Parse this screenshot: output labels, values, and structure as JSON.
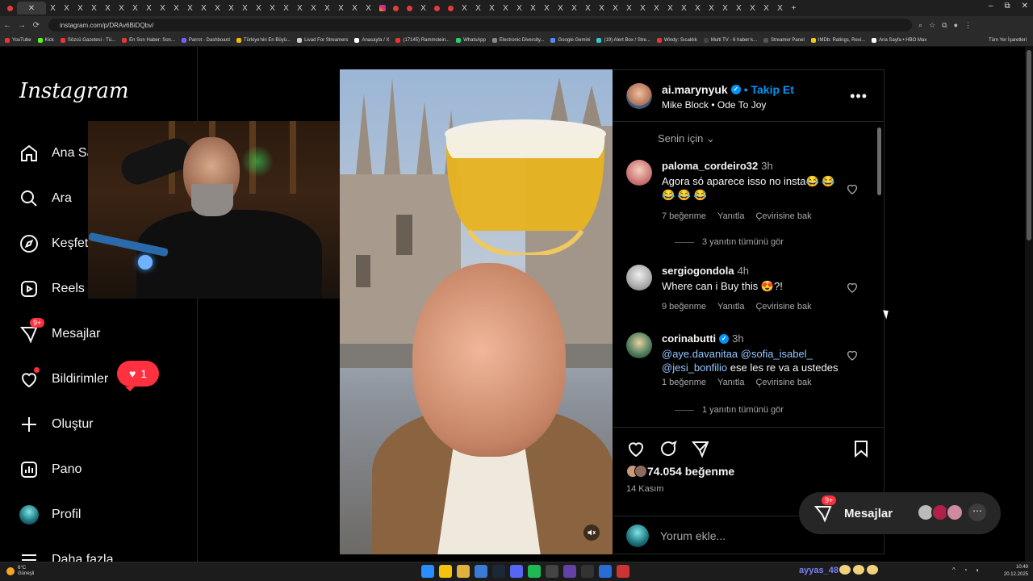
{
  "browser": {
    "url": "instagram.com/p/DRAv6BiDQbv/",
    "bookmarks": [
      "YouTube",
      "Kick",
      "Sözcü Gazetesi - Tü...",
      "En Son Haber: Son...",
      "Parrot - Dashboard",
      "Türkiye'nin En Büyü...",
      "Livad For Streamers",
      "Anasayfa / X",
      "(17145) Rammstein...",
      "WhatsApp",
      "Electronic Diversity...",
      "Google Gemini",
      "(19) Alert Box / Stre...",
      "Windy: Sıcaklık",
      "Multi TV - 6 haber k...",
      "Streamer Panel",
      "IMDb: Ratings, Revi...",
      "Ana Sayfa • HBO Max"
    ],
    "bookmarks_right": "Tüm Yer İşaretleri"
  },
  "sidebar": {
    "logo": "Instagram",
    "items": [
      {
        "label": "Ana Sayfa",
        "icon": "home-icon"
      },
      {
        "label": "Ara",
        "icon": "search-icon"
      },
      {
        "label": "Keşfet",
        "icon": "compass-icon"
      },
      {
        "label": "Reels",
        "icon": "reels-icon"
      },
      {
        "label": "Mesajlar",
        "icon": "messenger-icon",
        "badge": "9+"
      },
      {
        "label": "Bildirimler",
        "icon": "heart-icon"
      },
      {
        "label": "Oluştur",
        "icon": "plus-icon"
      },
      {
        "label": "Pano",
        "icon": "dashboard-icon"
      },
      {
        "label": "Profil",
        "icon": "avatar"
      },
      {
        "label": "Daha fazla",
        "icon": "menu-icon"
      }
    ],
    "notif_count": "1"
  },
  "post": {
    "username": "ai.marynyuk",
    "follow_label": "• Takip Et",
    "song": "Mike Block • Ode To Joy",
    "sort_label": "Senin için",
    "comments": [
      {
        "user": "paloma_cordeiro32",
        "time": "3h",
        "text_a": "Agora só aparece isso no insta😂 😂",
        "text_b": "😂 😂 😂",
        "likes": "7 beğenme",
        "reply": "Yanıtla",
        "translate": "Çevirisine bak",
        "thread": "3 yanıtın tümünü gör"
      },
      {
        "user": "sergiogondola",
        "time": "4h",
        "text_a": "Where can i Buy this 😍?!",
        "likes": "9 beğenme",
        "reply": "Yanıtla",
        "translate": "Çevirisine bak"
      },
      {
        "user": "corinabutti",
        "time": "3h",
        "mention1": "@aye.davanitaa",
        "mention2": "@sofia_isabel_",
        "mention3": "@jesi_bonfilio",
        "text_tail": "ese les re va a ustedes",
        "likes": "1 beğenme",
        "reply": "Yanıtla",
        "translate": "Çevirisine bak",
        "thread": "1 yanıtın tümünü gör"
      }
    ],
    "like_count": "74.054 beğenme",
    "date": "14 Kasım",
    "comment_placeholder": "Yorum ekle..."
  },
  "messages_pill": {
    "label": "Mesajlar",
    "badge": "9+"
  },
  "taskbar": {
    "temp": "6°C",
    "weather": "Güneşli",
    "stream_name": "ayyas_48",
    "time": "10:49",
    "date": "20.12.2025"
  },
  "colors": {
    "accent": "#0095f6",
    "badge": "#ff3040",
    "bg": "#000000"
  }
}
